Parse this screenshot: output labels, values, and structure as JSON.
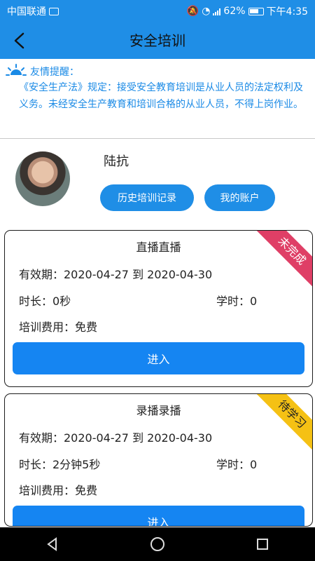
{
  "status_bar": {
    "carrier": "中国联通",
    "battery": "62%",
    "time": "下午4:35"
  },
  "header": {
    "title": "安全培训",
    "back_icon": "back-arrow-icon"
  },
  "notice": {
    "title": "友情提醒：",
    "text": "《安全生产法》规定：接受安全教育培训是从业人员的法定权利及义务。未经安全生产教育和培训合格的从业人员，不得上岗作业。",
    "icon": "sun-icon"
  },
  "profile": {
    "name": "陆抗",
    "history_button": "历史培训记录",
    "account_button": "我的账户"
  },
  "courses": [
    {
      "title": "直播直播",
      "validity": "有效期：2020-04-27 到 2020-04-30",
      "duration": "时长：0秒",
      "credit_hours": "学时：0",
      "fee": "培训费用：免费",
      "enter_button": "进入",
      "status": "未完成",
      "status_color": "#df3f66"
    },
    {
      "title": "录播录播",
      "validity": "有效期：2020-04-27 到 2020-04-30",
      "duration": "时长：2分钟5秒",
      "credit_hours": "学时：0",
      "fee": "培训费用：免费",
      "enter_button": "进入",
      "status": "待学习",
      "status_color": "#f5c114"
    }
  ],
  "colors": {
    "primary": "#1f8ee6",
    "button": "#1585f2",
    "notice_text": "#1a8ae6"
  }
}
